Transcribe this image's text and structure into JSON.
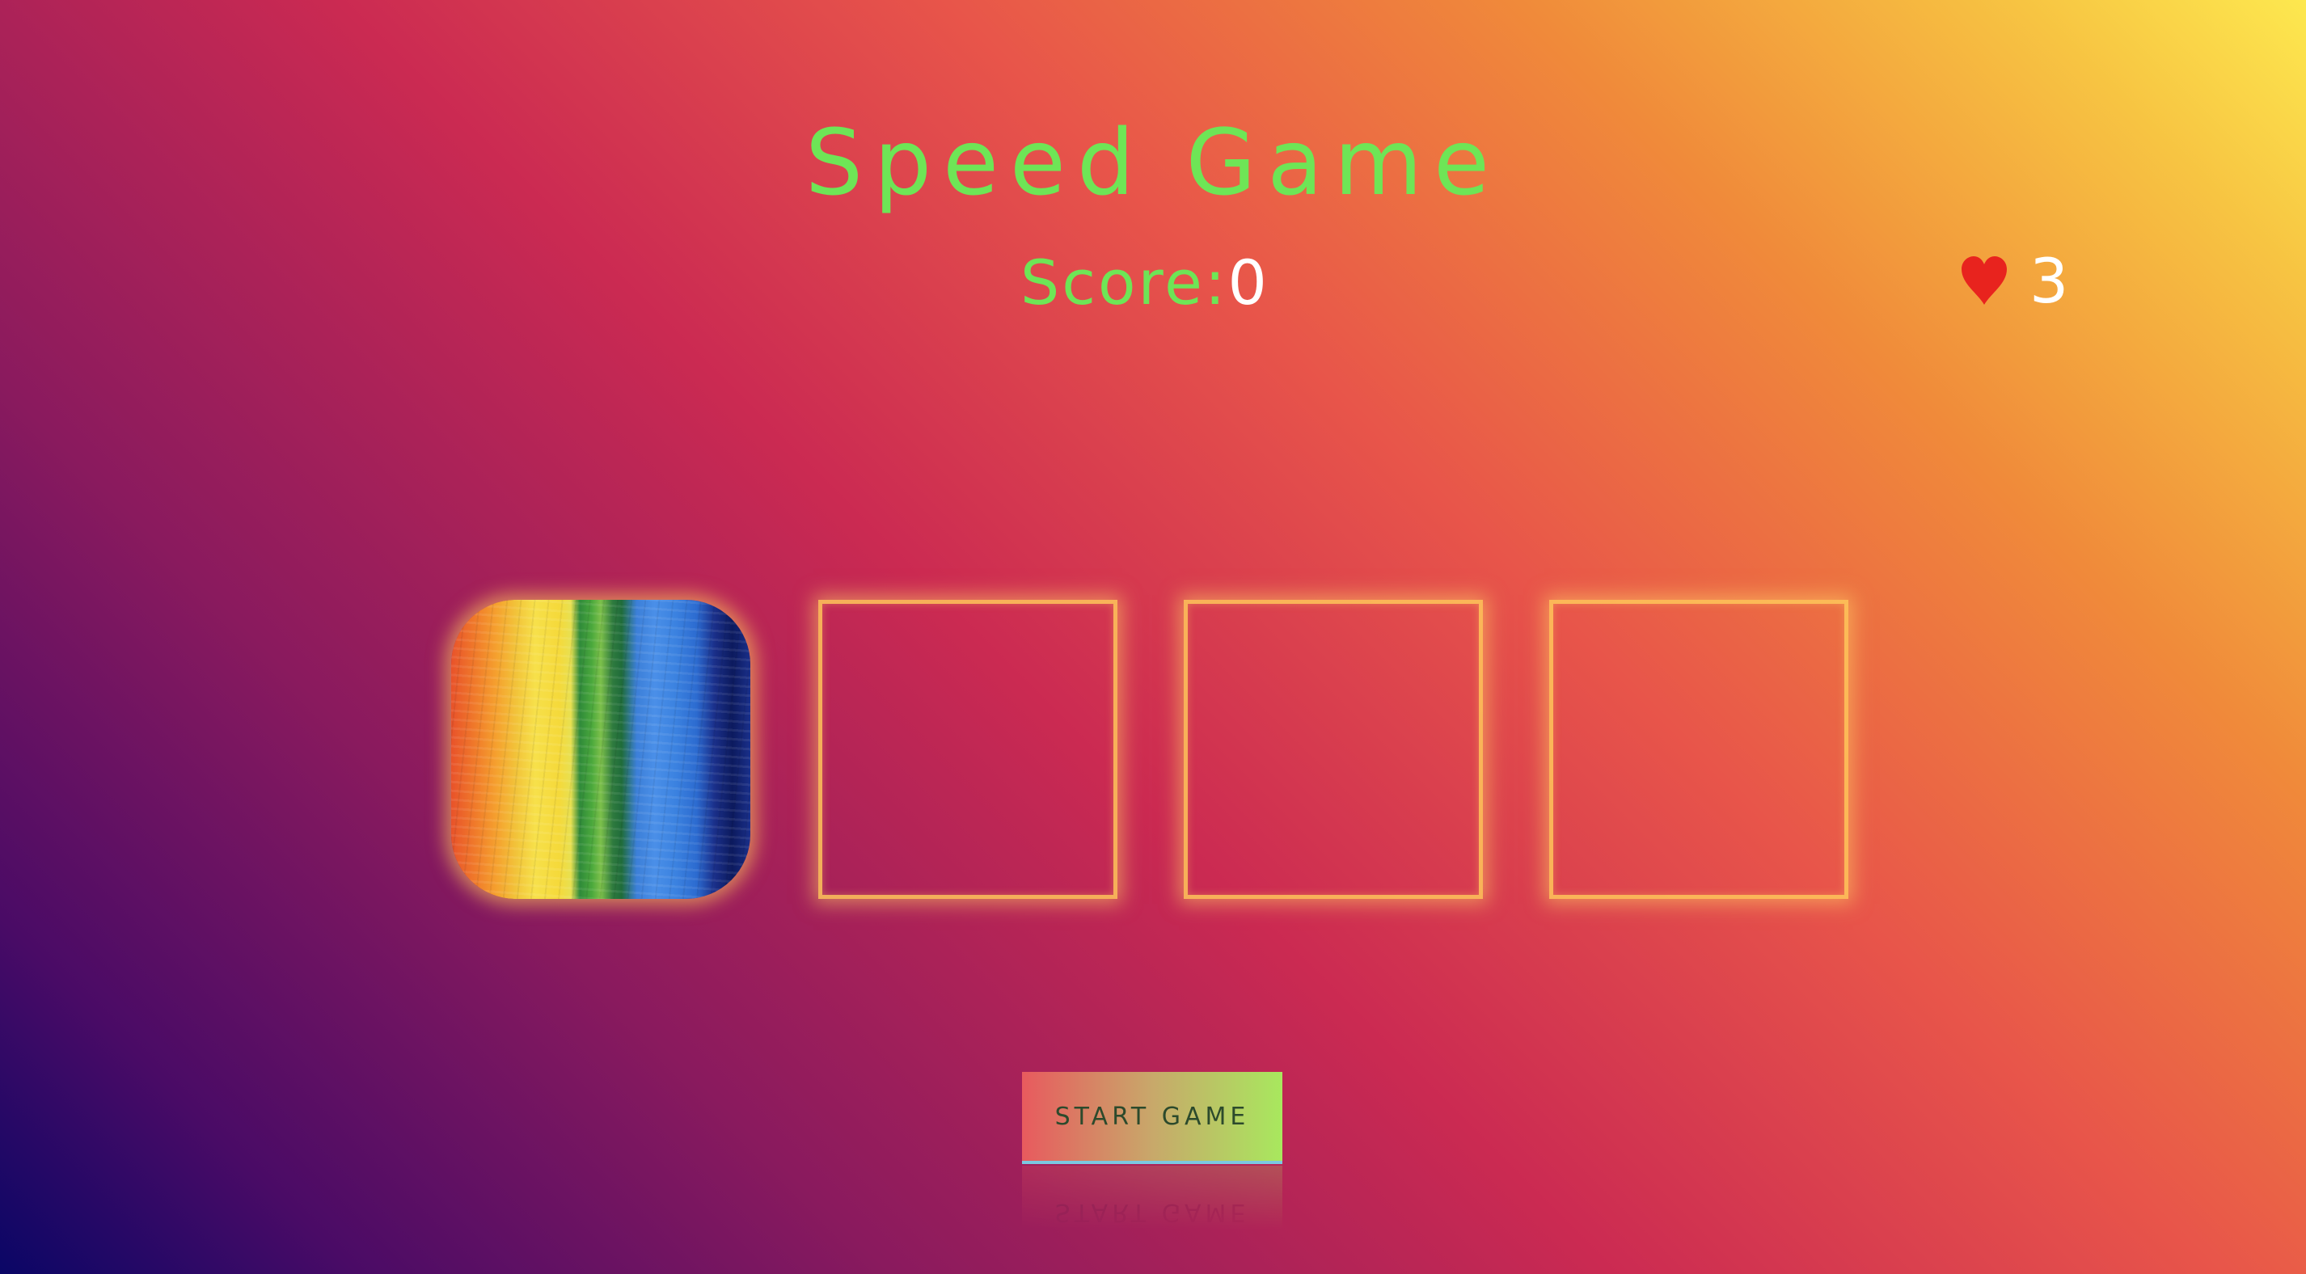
{
  "title": "Speed Game",
  "score": {
    "label": "Score:",
    "value": "0"
  },
  "lives": {
    "icon": "heart-icon",
    "count": "3"
  },
  "circles": [
    {
      "state": "active",
      "content": "paint-image"
    },
    {
      "state": "empty"
    },
    {
      "state": "empty"
    },
    {
      "state": "empty"
    }
  ],
  "start_button": {
    "label": "START GAME"
  },
  "colors": {
    "title": "#6ee556",
    "score_value": "#ffffff",
    "heart": "#e8231e",
    "glow": "#ffc85a"
  }
}
